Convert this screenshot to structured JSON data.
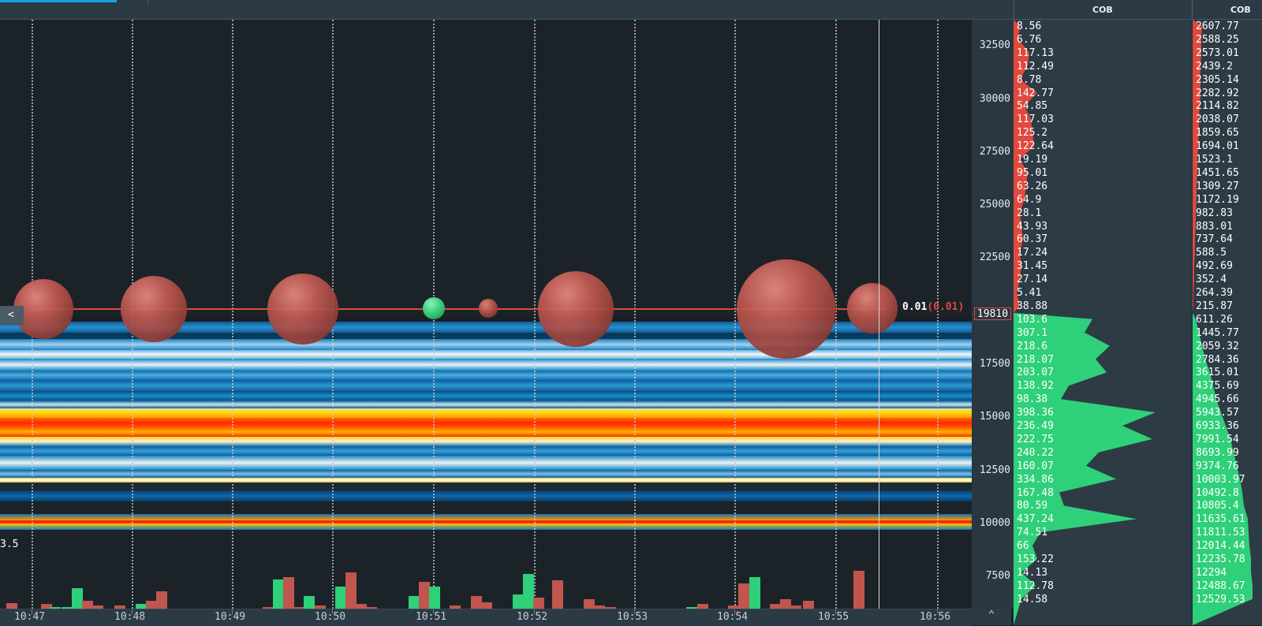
{
  "header": {
    "cob_left": "COB",
    "cob_right": "COB"
  },
  "chart": {
    "volume_label": "3.5",
    "collapse_icon": "<",
    "expand_icon": "^",
    "last_trade": {
      "value": "0.01",
      "change": "(0.01)"
    },
    "price_marker": "19810",
    "price_ticks": [
      "32500",
      "30000",
      "27500",
      "25000",
      "22500",
      "17500",
      "15000",
      "12500",
      "10000",
      "7500"
    ],
    "time_ticks": [
      "10:47",
      "10:48",
      "10:49",
      "10:50",
      "10:51",
      "10:52",
      "10:53",
      "10:54",
      "10:55",
      "10:56"
    ],
    "colors": {
      "sell": "#e0493e",
      "buy": "#2fd07a",
      "heat_low": "#0a6fb0",
      "heat_high": "#ff3b00"
    }
  },
  "cob_left": {
    "asks": [
      "8.56",
      "6.76",
      "117.13",
      "112.49",
      "8.78",
      "142.77",
      "54.85",
      "117.03",
      "125.2",
      "122.64",
      "19.19",
      "95.01",
      "63.26",
      "64.9",
      "28.1",
      "43.93",
      "60.37",
      "17.24",
      "31.45",
      "27.14",
      "5.41",
      "38.88"
    ],
    "bids": [
      "103.6",
      "307.1",
      "218.6",
      "218.07",
      "203.07",
      "138.92",
      "98.38",
      "398.36",
      "236.49",
      "222.75",
      "240.22",
      "160.07",
      "334.86",
      "167.48",
      "80.59",
      "437.24",
      "74.51",
      "66",
      "153.22",
      "14.13",
      "112.78",
      "14.58"
    ]
  },
  "cob_right": {
    "asks": [
      "2607.77",
      "2588.25",
      "2573.01",
      "2439.2",
      "2305.14",
      "2282.92",
      "2114.82",
      "2038.07",
      "1859.65",
      "1694.01",
      "1523.1",
      "1451.65",
      "1309.27",
      "1172.19",
      "982.83",
      "883.01",
      "737.64",
      "588.5",
      "492.69",
      "352.4",
      "264.39",
      "215.87"
    ],
    "bids": [
      "611.26",
      "1445.77",
      "2059.32",
      "2784.36",
      "3615.01",
      "4375.69",
      "4945.66",
      "5943.57",
      "6933.36",
      "7991.54",
      "8693.99",
      "9374.76",
      "10003.97",
      "10492.8",
      "10805.4",
      "11635.61",
      "11811.53",
      "12014.44",
      "12235.78",
      "12294",
      "12488.67",
      "12529.53"
    ]
  }
}
